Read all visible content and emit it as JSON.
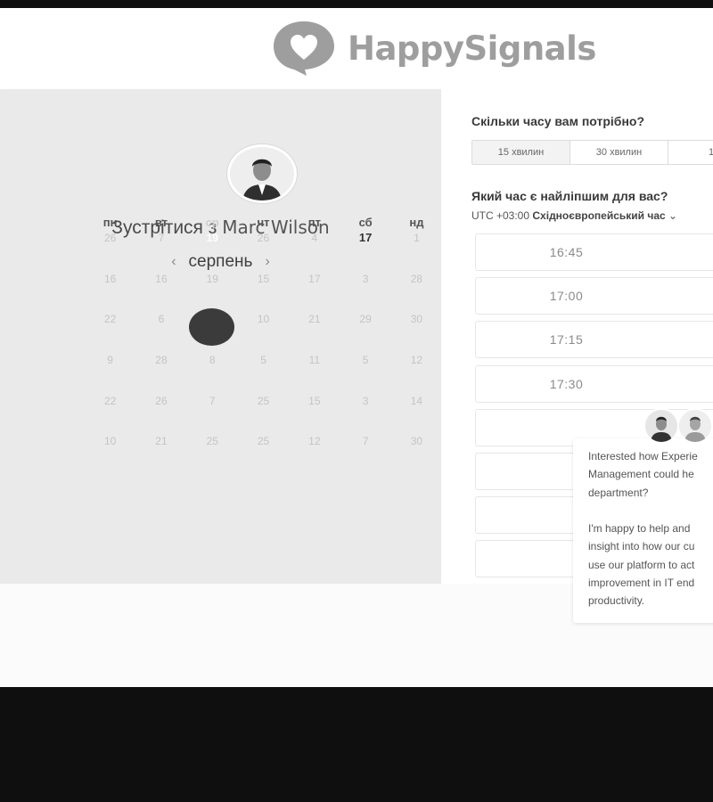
{
  "header": {
    "logo_text": "HappySignals"
  },
  "profile": {
    "meet_prefix": "Зустрітися з",
    "name": "Marc Wilson"
  },
  "calendar": {
    "month": "серпень",
    "prev_icon": "chevron-left-icon",
    "next_icon": "chevron-right-icon",
    "weekdays": [
      "пн",
      "вт",
      "ср",
      "чт",
      "пт",
      "сб",
      "нд"
    ],
    "weeks": [
      [
        "26",
        "7",
        "19",
        "26",
        "4",
        "17",
        "1"
      ],
      [
        "16",
        "16",
        "19",
        "15",
        "17",
        "3",
        "28"
      ],
      [
        "22",
        "6",
        "28",
        "10",
        "21",
        "29",
        "30"
      ],
      [
        "9",
        "28",
        "8",
        "5",
        "11",
        "5",
        "12"
      ],
      [
        "22",
        "26",
        "7",
        "25",
        "15",
        "3",
        "14"
      ],
      [
        "10",
        "21",
        "25",
        "25",
        "12",
        "7",
        "30"
      ]
    ],
    "selected_date": "19",
    "available_date": "17"
  },
  "booking": {
    "duration_question": "Скільки часу вам потрібно?",
    "durations": [
      "15 хвилин",
      "30 хвилин",
      "1 го"
    ],
    "time_question": "Який час є найліпшим для вас?",
    "timezone_prefix": "UTC +03:00",
    "timezone_name": "Східноєвропейський час",
    "slots": [
      "16:45",
      "17:00",
      "17:15",
      "17:30",
      "",
      "",
      "",
      ""
    ]
  },
  "chat": {
    "lines": [
      "Interested how Experie",
      "Management could he",
      "department?",
      "",
      "I'm happy to help and",
      "insight into how our cu",
      "use our platform to act",
      "improvement in IT end",
      "productivity."
    ]
  },
  "colors": {
    "selected_day": "#3b3b3b",
    "panel_bg": "#eaeaea",
    "logo": "#9e9e9e"
  }
}
